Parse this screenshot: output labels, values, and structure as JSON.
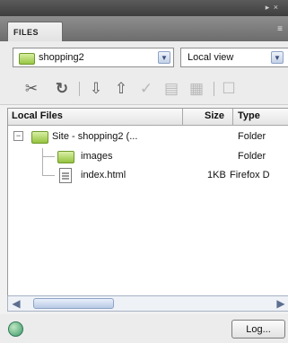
{
  "panel": {
    "tab_label": "FILES"
  },
  "site_select": {
    "value": "shopping2"
  },
  "view_select": {
    "value": "Local view"
  },
  "toolbar": {
    "icons": [
      "connect-icon",
      "refresh-icon",
      "get-files-icon",
      "put-files-icon",
      "check-out-icon",
      "check-in-icon",
      "sync-icon",
      "expand-icon"
    ]
  },
  "columns": {
    "name": "Local Files",
    "size": "Size",
    "type": "Type"
  },
  "rows": [
    {
      "name": "Site - shopping2 (...",
      "size": "",
      "type": "Folder"
    },
    {
      "name": "images",
      "size": "",
      "type": "Folder"
    },
    {
      "name": "index.html",
      "size": "1KB",
      "type": "Firefox D"
    }
  ],
  "status": {
    "log_label": "Log..."
  }
}
